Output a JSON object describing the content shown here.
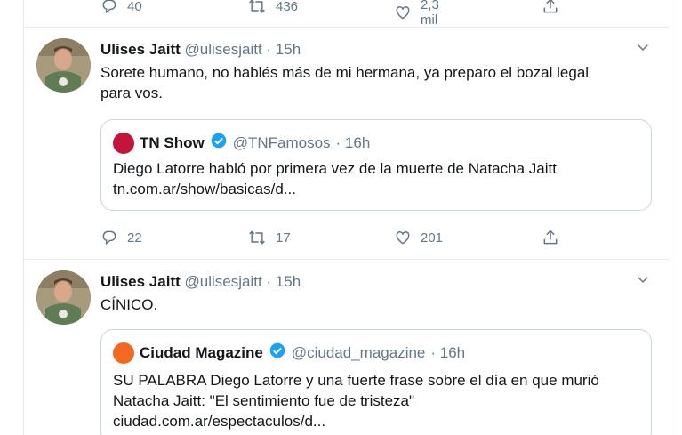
{
  "top_actions": {
    "reply_count": "40",
    "retweet_count": "436",
    "like_count": "2,3 mil"
  },
  "tweets": [
    {
      "name": "Ulises Jaitt",
      "handle": "@ulisesjaitt",
      "time": "· 15h",
      "text_line1": "Sorete humano, no hablés más de mi hermana, ya preparo el bozal legal",
      "text_line2": "para vos.",
      "quote": {
        "name": "TN Show",
        "handle": "@TNFamosos",
        "time": "· 16h",
        "line1": "Diego Latorre habló por primera vez de la muerte de Natacha Jaitt",
        "line2": "tn.com.ar/show/basicas/d...",
        "logo_color": "#c4143c"
      },
      "reply_count": "22",
      "retweet_count": "17",
      "like_count": "201"
    },
    {
      "name": "Ulises Jaitt",
      "handle": "@ulisesjaitt",
      "time": "· 15h",
      "text_line1": "CÍNICO.",
      "quote": {
        "name": "Ciudad Magazine",
        "handle": "@ciudad_magazine",
        "time": "· 16h",
        "line1": "SU PALABRA Diego Latorre y una fuerte frase sobre el día en que murió",
        "line2": "Natacha Jaitt: \"El sentimiento fue de tristeza\"",
        "line3": "ciudad.com.ar/espectaculos/d...",
        "logo_color": "#f26a22"
      }
    }
  ],
  "icons": {
    "reply": "reply-icon",
    "retweet": "retweet-icon",
    "like": "heart-icon",
    "share": "share-icon",
    "verified": "verified-badge-icon",
    "more": "chevron-down-icon"
  },
  "colors": {
    "text": "#14171a",
    "secondary": "#657786",
    "verified": "#1da1f2",
    "border": "#e6ecf0"
  }
}
